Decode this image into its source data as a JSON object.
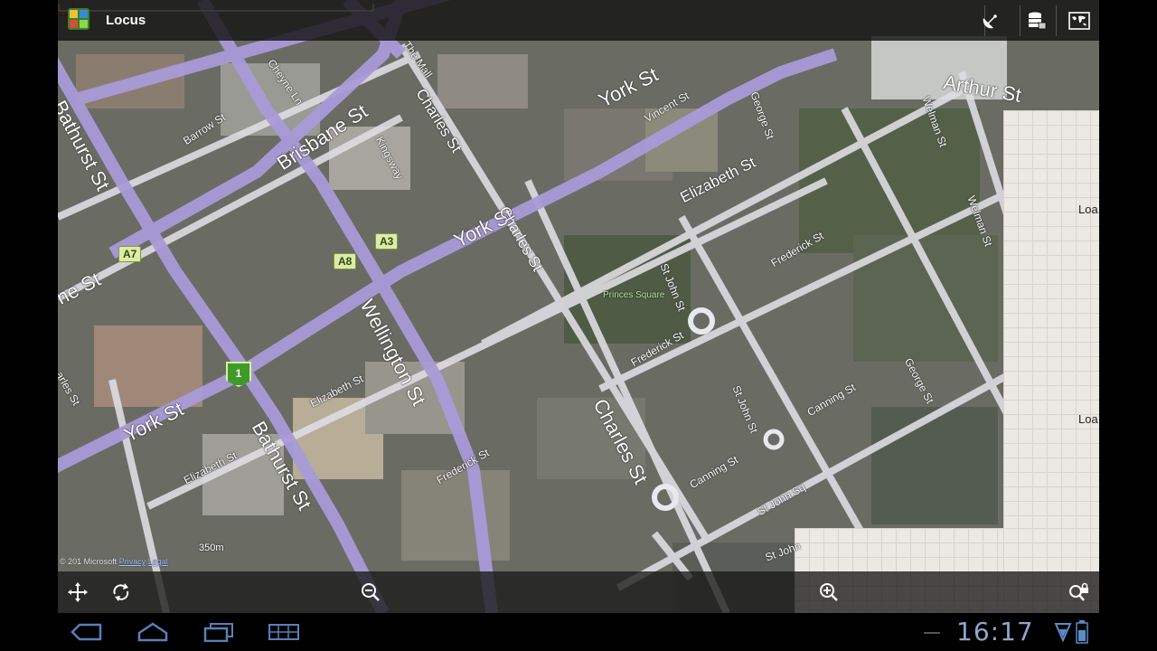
{
  "app": {
    "title": "Locus"
  },
  "map": {
    "streets": [
      {
        "name": "York St"
      },
      {
        "name": "York St"
      },
      {
        "name": "York St"
      },
      {
        "name": "Bathurst St"
      },
      {
        "name": "Bathurst St"
      },
      {
        "name": "Brisbane St"
      },
      {
        "name": "Charles St"
      },
      {
        "name": "Charles St"
      },
      {
        "name": "Charles St"
      },
      {
        "name": "Wellington St"
      },
      {
        "name": "Elizabeth St"
      },
      {
        "name": "Elizabeth St"
      },
      {
        "name": "Elizabeth St"
      },
      {
        "name": "Arthur St"
      },
      {
        "name": "Welman St"
      },
      {
        "name": "Welman St"
      },
      {
        "name": "George St"
      },
      {
        "name": "George St"
      },
      {
        "name": "St John St"
      },
      {
        "name": "St John St"
      },
      {
        "name": "Frederick St"
      },
      {
        "name": "Frederick St"
      },
      {
        "name": "Frederick St"
      },
      {
        "name": "Canning St"
      },
      {
        "name": "Canning St"
      },
      {
        "name": "Vincent St"
      },
      {
        "name": "Kingsway"
      },
      {
        "name": "Barrow St"
      },
      {
        "name": "Cheyne Ln"
      },
      {
        "name": "The Mall"
      },
      {
        "name": "St John Sq"
      },
      {
        "name": "St John"
      },
      {
        "name": "ne St"
      },
      {
        "name": "arles St"
      }
    ],
    "poi": "Princes Square",
    "road_shields": [
      "A7",
      "A8",
      "A3"
    ],
    "route_shield": "1",
    "loading_labels": [
      "Loa",
      "Loa"
    ],
    "scale_label": "350m",
    "copyright": {
      "prefix": "© 201",
      "provider": "Microsoft",
      "privacy": "Privacy",
      "legal": "Legal"
    }
  },
  "icons": {
    "top": [
      "satellite-dish-icon",
      "map-sources-icon",
      "world-map-icon"
    ],
    "bottom": [
      "move-icon",
      "rotate-icon",
      "zoom-out-icon",
      "zoom-in-icon",
      "lock-zoom-icon"
    ],
    "system": [
      "back-icon",
      "home-icon",
      "recent-apps-icon",
      "menu-icon",
      "wifi-icon",
      "battery-icon"
    ]
  },
  "colors": {
    "road_purple": "#a99bd8",
    "road_white": "#dedde3",
    "tile_background": "#ece9e4",
    "clock": "#8aa8cc"
  },
  "status": {
    "time": "16:17"
  }
}
